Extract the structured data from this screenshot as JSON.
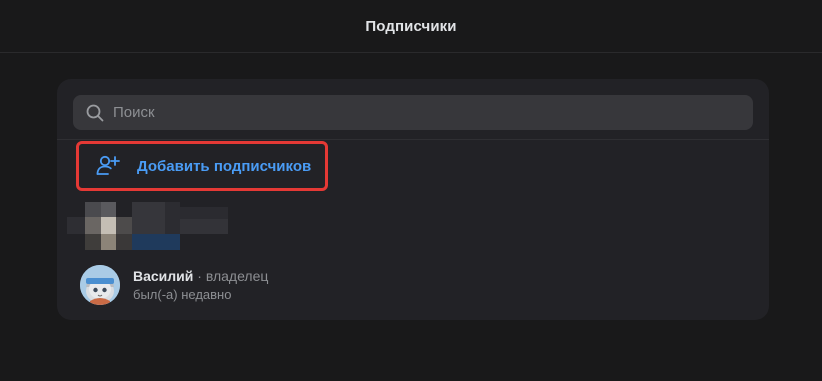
{
  "header": {
    "title": "Подписчики"
  },
  "search": {
    "placeholder": "Поиск",
    "icon": "search-icon"
  },
  "add_button": {
    "label": "Добавить подписчиков",
    "icon": "user-plus-icon",
    "color": "#4a9cf5",
    "highlight_color": "#e53935"
  },
  "members": [
    {
      "name": "Василий",
      "role": " · владелец",
      "status": "был(-а) недавно"
    }
  ],
  "colors": {
    "background": "#19191a",
    "card": "#222226",
    "search_bg": "#37373b",
    "text_secondary": "#8d8f93"
  }
}
